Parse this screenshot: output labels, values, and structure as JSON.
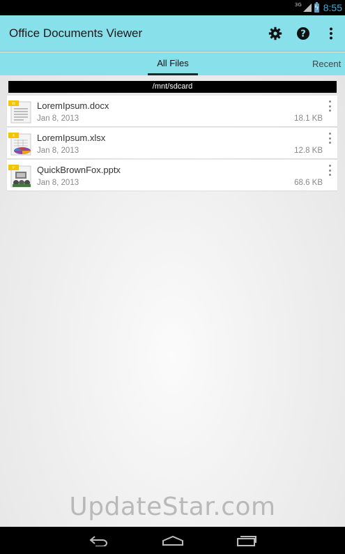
{
  "status_bar": {
    "network": "3G",
    "time": "8:55"
  },
  "action_bar": {
    "title": "Office Documents Viewer",
    "actions": [
      "settings",
      "help",
      "overflow"
    ]
  },
  "tabs": [
    {
      "label": "All Files",
      "selected": true
    },
    {
      "label": "Recent",
      "selected": false
    }
  ],
  "path": "/mnt/sdcard",
  "files": [
    {
      "name": "LoremIpsum.docx",
      "date": "Jan 8, 2013",
      "size": "18.1 KB",
      "icon": "docx-icon"
    },
    {
      "name": "LoremIpsum.xlsx",
      "date": "Jan 8, 2013",
      "size": "12.8 KB",
      "icon": "xlsx-icon"
    },
    {
      "name": "QuickBrownFox.pptx",
      "date": "Jan 8, 2013",
      "size": "68.6 KB",
      "icon": "pptx-icon"
    }
  ],
  "watermark": "UpdateStar.com",
  "colors": {
    "action_bar": "#87e0ea",
    "status_accent": "#33b5e5"
  }
}
